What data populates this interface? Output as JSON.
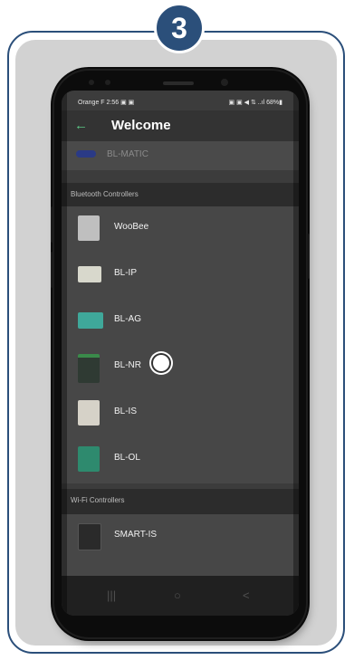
{
  "step_badge": "3",
  "status_bar": {
    "left": "Orange F  2:56 ▣ ▣",
    "right": "▣ ▣ ◀ ⇅ ..ıl 68%▮"
  },
  "app_bar": {
    "back_icon": "arrow-left-icon",
    "title": "Welcome"
  },
  "scrolled_item": {
    "label": "BL-MATIC"
  },
  "sections": {
    "bluetooth": {
      "header": "Bluetooth Controllers",
      "items": [
        {
          "label": "WooBee",
          "color": "#bfbfbf"
        },
        {
          "label": "BL-IP",
          "color": "#d8d8cc"
        },
        {
          "label": "BL-AG",
          "color": "#3fa89a"
        },
        {
          "label": "BL-NR",
          "color": "#2f3a33"
        },
        {
          "label": "BL-IS",
          "color": "#d6d2c8"
        },
        {
          "label": "BL-OL",
          "color": "#2e8a6e"
        }
      ]
    },
    "wifi": {
      "header": "Wi-Fi Controllers",
      "items": [
        {
          "label": "SMART-IS",
          "color": "#2a2a2a"
        }
      ]
    }
  },
  "navbar": {
    "recent": "|||",
    "home": "○",
    "back": "<"
  },
  "colors": {
    "badge": "#2b4f7a",
    "accent_green": "#5cc886"
  }
}
